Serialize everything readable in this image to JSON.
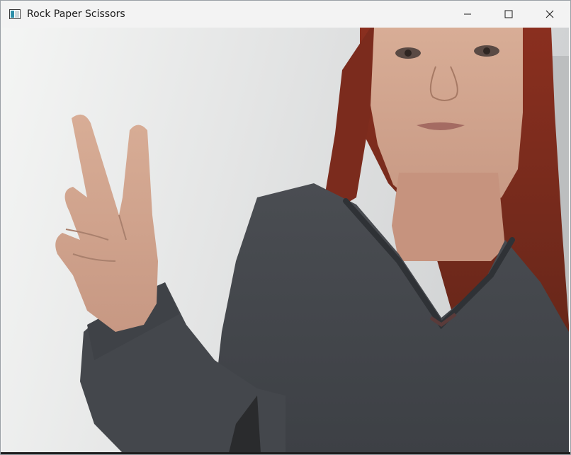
{
  "window": {
    "title": "Rock Paper Scissors",
    "icons": {
      "app": "window-app-icon",
      "minimize": "minimize-icon",
      "maximize": "maximize-icon",
      "close": "close-icon"
    }
  },
  "feed": {
    "description_icon": "camera-feed"
  }
}
